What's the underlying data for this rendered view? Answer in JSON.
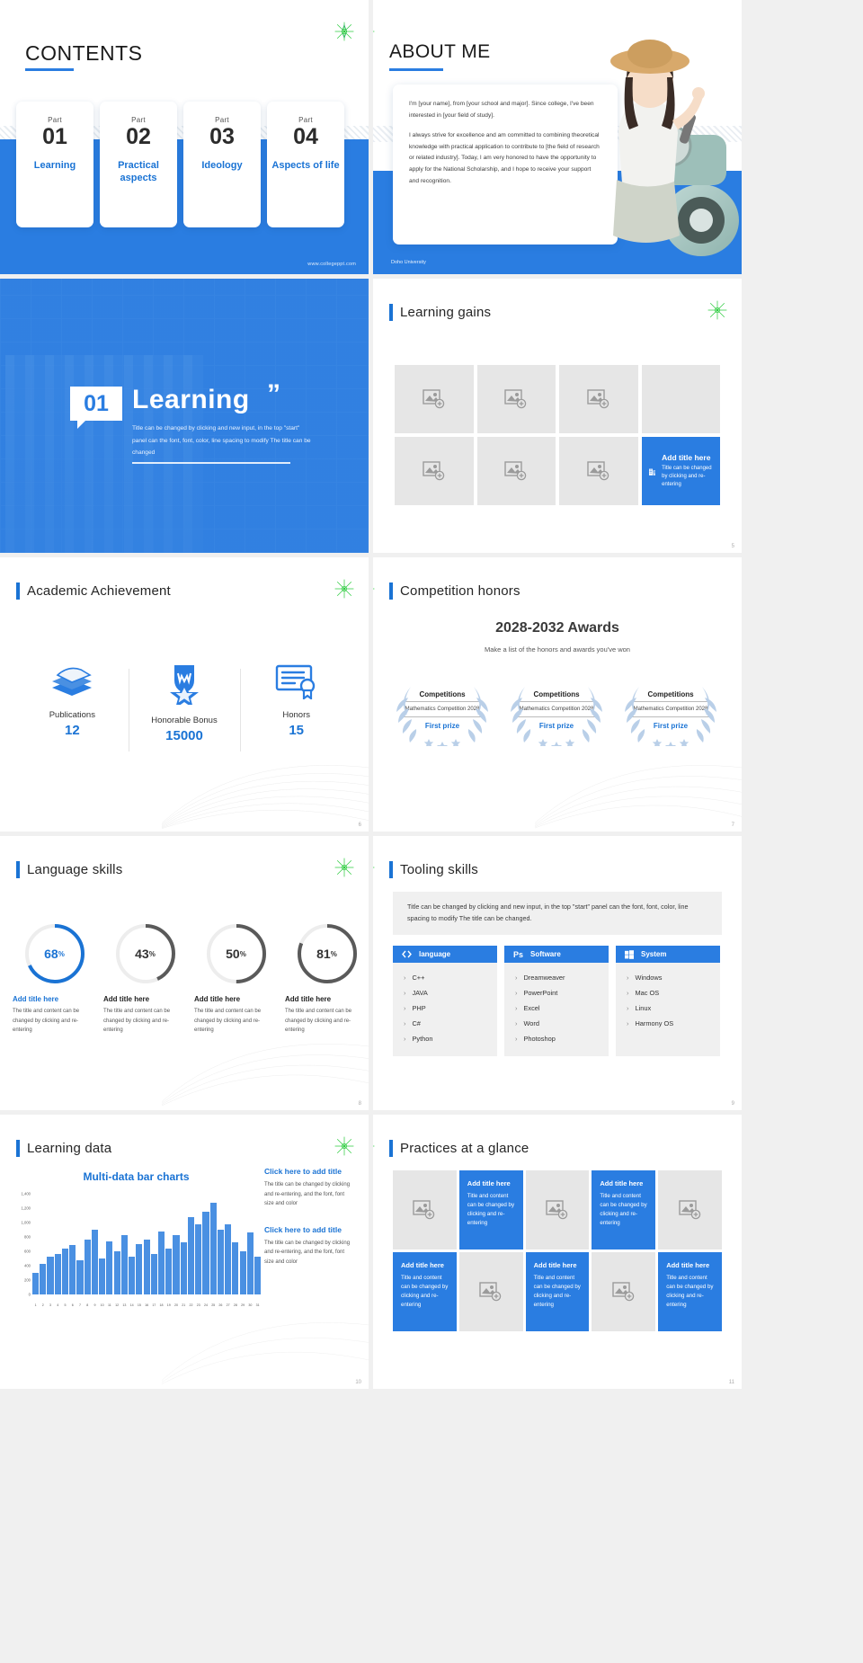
{
  "brand": {
    "blue": "#2a7de1",
    "accent": "#1a73d4",
    "grey": "#e6e6e6"
  },
  "footer": {
    "url": "www.collegeppt.com",
    "university": "Doho University"
  },
  "slides": [
    {
      "n": 1,
      "title": "CONTENTS",
      "cards": [
        {
          "part": "Part",
          "no": "01",
          "label": "Learning"
        },
        {
          "part": "Part",
          "no": "02",
          "label": "Practical aspects"
        },
        {
          "part": "Part",
          "no": "03",
          "label": "Ideology"
        },
        {
          "part": "Part",
          "no": "04",
          "label": "Aspects of life"
        }
      ]
    },
    {
      "n": 2,
      "title": "ABOUT ME",
      "para1": "I'm [your name], from [your school and major]. Since college, I've been interested in [your field of study].",
      "para2": "I always strive for excellence and am committed to combining theoretical knowledge with practical application to contribute to [the field of research or related industry]. Today, I am very honored to have the opportunity to apply for the National Scholarship, and I hope to receive your support and recognition."
    },
    {
      "n": 3,
      "number": "01",
      "title": "Learning",
      "quote": "”",
      "desc": "Title can be changed by clicking and new input, in the top \"start\" panel can the font, font, color, line spacing to modify The title can be changed"
    },
    {
      "n": 5,
      "title": "Learning gains",
      "cta": {
        "t1": "Add title here",
        "t2": "Title can be changed by clicking and re-entering"
      },
      "placeholders": 7
    },
    {
      "n": 6,
      "title": "Academic Achievement",
      "stats": [
        {
          "icon": "books-icon",
          "label": "Publications",
          "value": "12"
        },
        {
          "icon": "medal-icon",
          "label": "Honorable Bonus",
          "value": "15000"
        },
        {
          "icon": "certificate-icon",
          "label": "Honors",
          "value": "15"
        }
      ]
    },
    {
      "n": 7,
      "title": "Competition honors",
      "heading": "2028-2032 Awards",
      "subheading": "Make a list of the honors and awards you've won",
      "awards": [
        {
          "name": "Competitions",
          "event": "Mathematics Competition 2028",
          "prize": "First prize"
        },
        {
          "name": "Competitions",
          "event": "Mathematics Competition 2028",
          "prize": "First prize"
        },
        {
          "name": "Competitions",
          "event": "Mathematics Competition 2028",
          "prize": "First prize"
        }
      ]
    },
    {
      "n": 8,
      "title": "Language skills",
      "donuts": [
        {
          "pct": 68,
          "suffix": "%",
          "title": "Add title here",
          "text": "The title and content can be changed by clicking and re-entering",
          "color": "#1a73d4",
          "active": true
        },
        {
          "pct": 43,
          "suffix": "%",
          "title": "Add title here",
          "text": "The title and content can be changed by clicking and re-entering",
          "color": "#5a5a5a",
          "active": false
        },
        {
          "pct": 50,
          "suffix": "%",
          "title": "Add title here",
          "text": "The title and content can be changed by clicking and re-entering",
          "color": "#5a5a5a",
          "active": false
        },
        {
          "pct": 81,
          "suffix": "%",
          "title": "Add title here",
          "text": "The title and content can be changed by clicking and re-entering",
          "color": "#5a5a5a",
          "active": false
        }
      ]
    },
    {
      "n": 9,
      "title": "Tooling skills",
      "intro": "Title can be changed by clicking and new input, in the top \"start\" panel can the font, font, color, line spacing to modify The title can be changed.",
      "columns": [
        {
          "icon": "code-icon",
          "head": "language",
          "items": [
            "C++",
            "JAVA",
            "PHP",
            "C#",
            "Python"
          ]
        },
        {
          "icon": "photoshop-icon",
          "head": "Software",
          "items": [
            "Dreamweaver",
            "PowerPoint",
            "Excel",
            "Word",
            "Photoshop"
          ]
        },
        {
          "icon": "windows-icon",
          "head": "System",
          "items": [
            "Windows",
            "Mac OS",
            "Linux",
            "Harmony OS"
          ]
        }
      ]
    },
    {
      "n": 10,
      "title": "Learning data",
      "panels": [
        {
          "head": "Click here to add title",
          "text": "The title can be changed by clicking and re-entering, and the font, font size and color"
        },
        {
          "head": "Click here to add title",
          "text": "The title can be changed by clicking and re-entering, and the font, font size and color"
        }
      ]
    },
    {
      "n": 11,
      "title": "Practices at a glance",
      "cells": [
        {
          "type": "image"
        },
        {
          "type": "text",
          "t1": "Add title here",
          "t2": "Title and content can be changed by clicking and re-entering"
        },
        {
          "type": "image"
        },
        {
          "type": "text",
          "t1": "Add title here",
          "t2": "Title and content can be changed by clicking and re-entering"
        },
        {
          "type": "image"
        },
        {
          "type": "text",
          "t1": "Add title here",
          "t2": "Title and content can be changed by clicking and re-entering"
        },
        {
          "type": "image"
        },
        {
          "type": "text",
          "t1": "Add title here",
          "t2": "Title and content can be changed by clicking and re-entering"
        },
        {
          "type": "image"
        },
        {
          "type": "text",
          "t1": "Add title here",
          "t2": "Title and content can be changed by clicking and re-entering"
        }
      ]
    }
  ],
  "page_numbers": {
    "s5": "5",
    "s6": "6",
    "s7": "7",
    "s8": "8",
    "s9": "9",
    "s10": "10",
    "s11": "11"
  },
  "chart_data": {
    "type": "bar",
    "title": "Multi-data bar charts",
    "xlabel": "",
    "ylabel": "",
    "ylim": [
      0,
      1400
    ],
    "yticks": [
      0,
      200,
      400,
      600,
      800,
      1000,
      1200,
      1400
    ],
    "ytick_labels": [
      "0",
      "200",
      "400",
      "600",
      "800",
      "1,000",
      "1,200",
      "1,400"
    ],
    "grid": false,
    "legend": "none",
    "categories": [
      "1",
      "2",
      "3",
      "4",
      "5",
      "6",
      "7",
      "8",
      "9",
      "10",
      "11",
      "12",
      "13",
      "14",
      "15",
      "16",
      "17",
      "18",
      "19",
      "20",
      "21",
      "22",
      "23",
      "24",
      "25",
      "26",
      "27",
      "28",
      "29",
      "30",
      "31"
    ],
    "values": [
      300,
      420,
      520,
      560,
      640,
      690,
      480,
      760,
      900,
      500,
      740,
      600,
      830,
      520,
      700,
      760,
      560,
      880,
      640,
      820,
      720,
      1080,
      980,
      1150,
      1280,
      900,
      980,
      720,
      600,
      860,
      520
    ]
  }
}
